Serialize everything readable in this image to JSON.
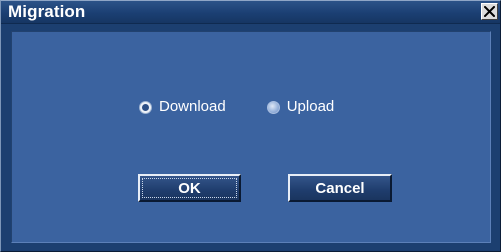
{
  "window": {
    "title": "Migration",
    "close_icon": "close-icon"
  },
  "radio_group": {
    "options": [
      {
        "label": "Download",
        "selected": true
      },
      {
        "label": "Upload",
        "selected": false
      }
    ]
  },
  "buttons": {
    "ok_label": "OK",
    "cancel_label": "Cancel"
  },
  "colors": {
    "frame": "#1c3f70",
    "panel": "#3b63a0",
    "text": "#ffffff"
  }
}
